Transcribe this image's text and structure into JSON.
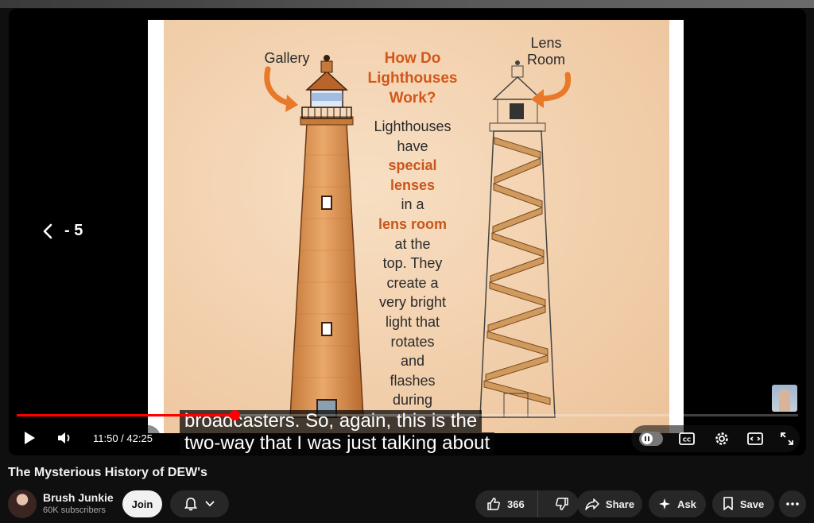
{
  "video": {
    "seek_back_label": "- 5",
    "captions": [
      "broadcasters. So, again, this is the",
      "two-way that I was just talking about"
    ],
    "time_display": "11:50 / 42:25",
    "progress_fraction": 0.2789,
    "slide": {
      "title": "How Do Lighthouses Work?",
      "gallery_label": "Gallery",
      "lens_room_label": "Lens Room",
      "body_lines": [
        {
          "text": "Lighthouses",
          "em": false
        },
        {
          "text": "have",
          "em": false
        },
        {
          "text": "special",
          "em": true
        },
        {
          "text": "lenses",
          "em": true
        },
        {
          "text": "in a",
          "em": false
        },
        {
          "text": "lens room",
          "em": true
        },
        {
          "text": "at the",
          "em": false
        },
        {
          "text": "top. They",
          "em": false
        },
        {
          "text": "create a",
          "em": false
        },
        {
          "text": "very bright",
          "em": false
        },
        {
          "text": "light that",
          "em": false
        },
        {
          "text": "rotates",
          "em": false
        },
        {
          "text": "and",
          "em": false
        },
        {
          "text": "flashes",
          "em": false
        },
        {
          "text": "during",
          "em": false
        }
      ]
    }
  },
  "meta": {
    "title": "The Mysterious History of DEW's",
    "channel_name": "Brush Junkie",
    "subscribers": "60K subscribers",
    "join_label": "Join",
    "like_count": "366",
    "share_label": "Share",
    "ask_label": "Ask",
    "save_label": "Save"
  },
  "colors": {
    "accent": "#ff0000",
    "slide_em": "#c8561c",
    "arrow": "#e8782a"
  }
}
